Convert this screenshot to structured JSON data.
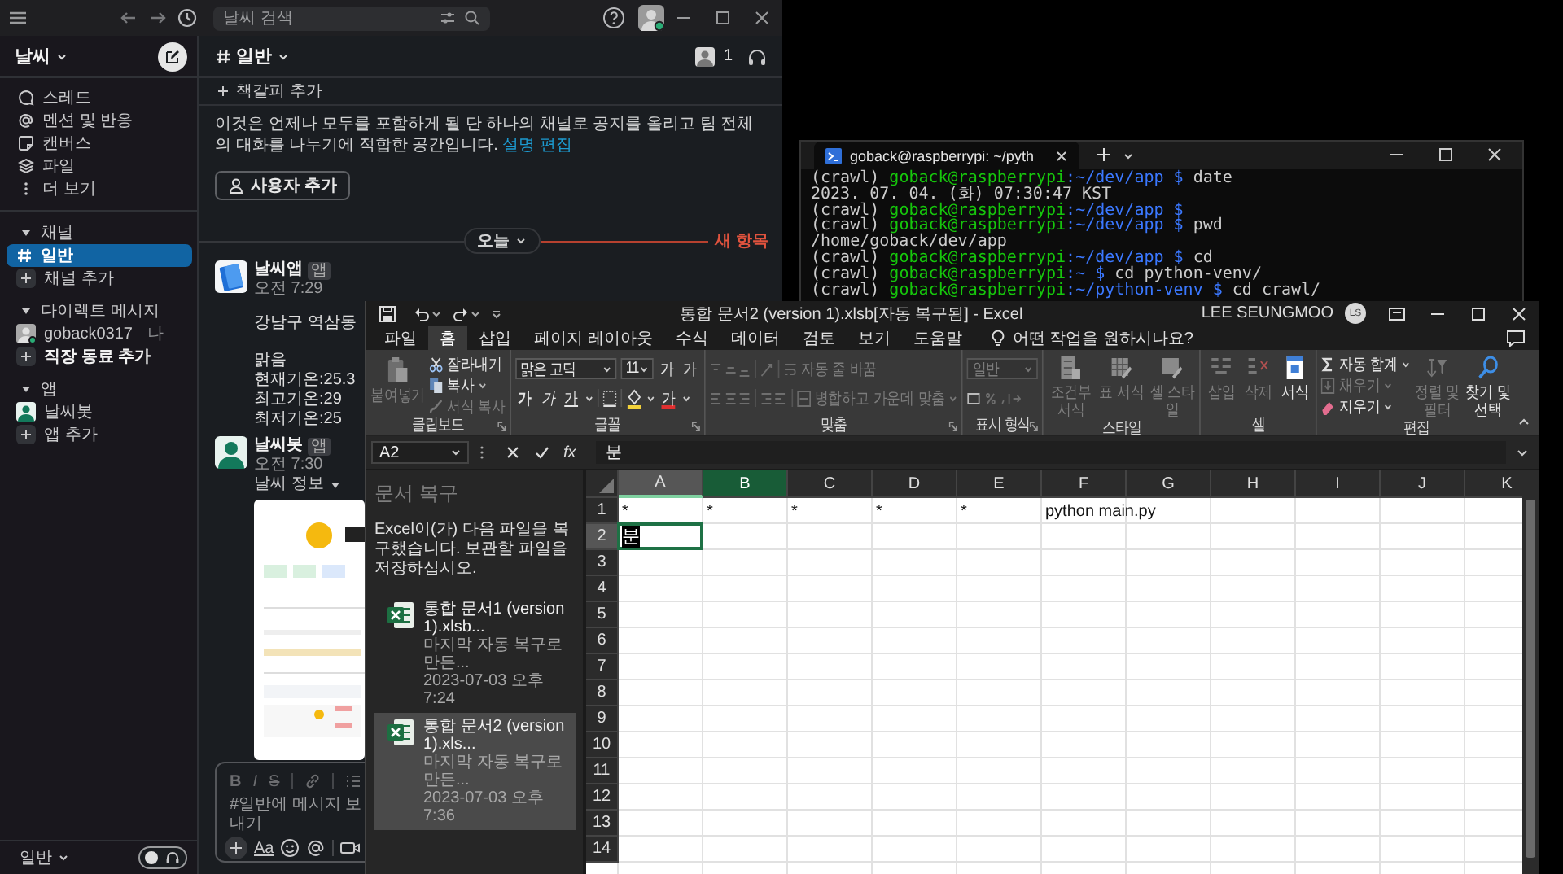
{
  "slack": {
    "titlebar": {
      "search_placeholder": "날씨 검색",
      "online": true
    },
    "workspace": "날씨",
    "nav": [
      {
        "label": "스레드",
        "kind": "threads"
      },
      {
        "label": "멘션 및 반응",
        "kind": "mentions"
      },
      {
        "label": "캔버스",
        "kind": "canvas"
      },
      {
        "label": "파일",
        "kind": "files"
      },
      {
        "label": "더 보기",
        "kind": "more"
      }
    ],
    "sections": [
      {
        "title": "채널",
        "expanded": true,
        "items": [
          {
            "label": "일반",
            "kind": "channel",
            "selected": true,
            "unread": false
          },
          {
            "label": "채널 추가",
            "kind": "add",
            "selected": false,
            "unread": false
          }
        ]
      },
      {
        "title": "다이렉트 메시지",
        "expanded": true,
        "items": [
          {
            "label": "goback0317",
            "suffix": "나",
            "kind": "user",
            "online": true,
            "selected": false,
            "unread": false
          },
          {
            "label": "직장 동료 추가",
            "kind": "add",
            "selected": false,
            "unread": true
          }
        ]
      },
      {
        "title": "앱",
        "expanded": true,
        "items": [
          {
            "label": "날씨봇",
            "kind": "app",
            "selected": false,
            "unread": false
          },
          {
            "label": "앱 추가",
            "kind": "add",
            "selected": false,
            "unread": false
          }
        ]
      }
    ],
    "footer": {
      "label": "일반"
    },
    "channel": {
      "name": "일반",
      "member_count": "1",
      "bookmark": "책갈피 추가",
      "intro": "이것은 언제나 모두를 포함하게 될 단 하나의 채널로 공지를 올리고 팀 전체의 대화를 나누기에 적합한 공간입니다.",
      "intro_link": "설명 편집",
      "add_button": "사용자 추가"
    },
    "divider": {
      "label": "오늘",
      "new_label": "새 항목"
    },
    "messages": [
      {
        "author": "날씨앱",
        "badge": "앱",
        "time": "오전 7:29",
        "paragraphs": [
          [
            "강남구 역삼동"
          ],
          [
            "맑음",
            "현재기온:25.3",
            "최고기온:29",
            "최저기온:25"
          ]
        ]
      },
      {
        "author": "날씨봇",
        "badge": "앱",
        "time": "오전 7:30",
        "attachment_title": "날씨 정보"
      }
    ],
    "composer": {
      "format_buttons": [
        "B",
        "I",
        "S"
      ],
      "placeholder": "#일반에 메시지 보내기",
      "text_button": "Aa"
    }
  },
  "terminal": {
    "tab_title": "goback@raspberrypi: ~/pyth",
    "lines": [
      {
        "kind": "prompt",
        "env": "(crawl)",
        "host": "goback@raspberrypi",
        "path": ":~/dev/app $",
        "cmd": "date"
      },
      {
        "kind": "output",
        "text": "2023. 07. 04. (화) 07:30:47 KST"
      },
      {
        "kind": "prompt",
        "env": "(crawl)",
        "host": "goback@raspberrypi",
        "path": ":~/dev/app $"
      },
      {
        "kind": "prompt",
        "env": "(crawl)",
        "host": "goback@raspberrypi",
        "path": ":~/dev/app $",
        "cmd": "pwd"
      },
      {
        "kind": "output",
        "text": "/home/goback/dev/app"
      },
      {
        "kind": "prompt",
        "env": "(crawl)",
        "host": "goback@raspberrypi",
        "path": ":~/dev/app $",
        "cmd": "cd"
      },
      {
        "kind": "prompt",
        "env": "(crawl)",
        "host": "goback@raspberrypi",
        "path": ":~ $",
        "cmd": "cd python-venv/"
      },
      {
        "kind": "prompt",
        "env": "(crawl)",
        "host": "goback@raspberrypi",
        "path": ":~/python-venv $",
        "cmd": "cd crawl/"
      }
    ]
  },
  "excel": {
    "title": "통합 문서2 (version 1).xlsb[자동 복구됨] - Excel",
    "user": "LEE SEUNGMOO",
    "user_initials": "LS",
    "tabs": [
      {
        "label": "파일",
        "selected": false
      },
      {
        "label": "홈",
        "selected": true
      },
      {
        "label": "삽입",
        "selected": false
      },
      {
        "label": "페이지 레이아웃",
        "selected": false
      },
      {
        "label": "수식",
        "selected": false
      },
      {
        "label": "데이터",
        "selected": false
      },
      {
        "label": "검토",
        "selected": false
      },
      {
        "label": "보기",
        "selected": false
      },
      {
        "label": "도움말",
        "selected": false
      }
    ],
    "tell_me": "어떤 작업을 원하시나요?",
    "ribbon": {
      "clipboard": {
        "label": "클립보드",
        "paste": {
          "label": "붙여넣기",
          "disabled": true
        },
        "cut": {
          "label": "잘라내기",
          "disabled": false
        },
        "copy": {
          "label": "복사",
          "disabled": false
        },
        "painter": {
          "label": "서식 복사",
          "disabled": true
        }
      },
      "font": {
        "label": "글꼴",
        "family": "맑은 고딕",
        "size": "11",
        "grow": "가",
        "shrink": "가",
        "bold": "가",
        "italic": "가",
        "underline": "가",
        "color_letter": "가"
      },
      "alignment": {
        "label": "맞춤",
        "wrap": {
          "label": "자동 줄 바꿈",
          "disabled": true
        },
        "merge": {
          "label": "병합하고 가운데 맞춤",
          "disabled": true
        }
      },
      "number": {
        "label": "표시 형식",
        "format": {
          "label": "일반",
          "disabled": true
        }
      },
      "styles": {
        "label": "스타일",
        "items": [
          {
            "label": "조건부 서식",
            "disabled": true
          },
          {
            "label": "표 서식",
            "disabled": true
          },
          {
            "label": "셀 스타일",
            "disabled": true
          }
        ]
      },
      "cells": {
        "label": "셀",
        "items": [
          {
            "label": "삽입",
            "disabled": true
          },
          {
            "label": "삭제",
            "disabled": true
          },
          {
            "label": "서식",
            "disabled": false
          }
        ]
      },
      "editing": {
        "label": "편집",
        "autosum": {
          "label": "자동 합계",
          "disabled": false
        },
        "fill": {
          "label": "채우기",
          "disabled": true
        },
        "clear": {
          "label": "지우기",
          "disabled": false
        },
        "sort": {
          "label": "정렬 및 필터",
          "disabled": true
        },
        "find": {
          "label": "찾기 및 선택",
          "disabled": false
        }
      }
    },
    "formula_bar": {
      "name_box": "A2",
      "function_button": "fx",
      "value": "분"
    },
    "recovery": {
      "title": "문서 복구",
      "message": "Excel이(가) 다음 파일을 복구했습니다. 보관할 파일을 저장하십시오.",
      "files": [
        {
          "name": "통합 문서1 (version 1).xlsb...",
          "note": "마지막 자동 복구로 만든...",
          "time": "2023-07-03 오후 7:24",
          "selected": false
        },
        {
          "name": "통합 문서2 (version 1).xls...",
          "note": "마지막 자동 복구로 만든...",
          "time": "2023-07-03 오후 7:36",
          "selected": true
        }
      ]
    },
    "columns": [
      {
        "label": "A",
        "active": true,
        "selected": false
      },
      {
        "label": "B",
        "active": false,
        "selected": true
      },
      {
        "label": "C",
        "active": false,
        "selected": false
      },
      {
        "label": "D",
        "active": false,
        "selected": false
      },
      {
        "label": "E",
        "active": false,
        "selected": false
      },
      {
        "label": "F",
        "active": false,
        "selected": false
      },
      {
        "label": "G",
        "active": false,
        "selected": false
      },
      {
        "label": "H",
        "active": false,
        "selected": false
      },
      {
        "label": "I",
        "active": false,
        "selected": false
      },
      {
        "label": "J",
        "active": false,
        "selected": false
      },
      {
        "label": "K",
        "active": false,
        "selected": false
      }
    ],
    "rows": [
      {
        "label": "1",
        "active": false,
        "cells": [
          {
            "text": "*",
            "selected": false,
            "composing": false
          },
          {
            "text": "*",
            "selected": false,
            "composing": false
          },
          {
            "text": "*",
            "selected": false,
            "composing": false
          },
          {
            "text": "*",
            "selected": false,
            "composing": false
          },
          {
            "text": "*",
            "selected": false,
            "composing": false
          },
          {
            "text": "python main.py",
            "selected": false,
            "composing": false
          }
        ]
      },
      {
        "label": "2",
        "active": true,
        "cells": [
          {
            "text": "분",
            "selected": true,
            "composing": true
          }
        ]
      },
      {
        "label": "3",
        "active": false
      },
      {
        "label": "4",
        "active": false
      },
      {
        "label": "5",
        "active": false
      },
      {
        "label": "6",
        "active": false
      },
      {
        "label": "7",
        "active": false
      },
      {
        "label": "8",
        "active": false
      },
      {
        "label": "9",
        "active": false
      },
      {
        "label": "10",
        "active": false
      },
      {
        "label": "11",
        "active": false
      },
      {
        "label": "12",
        "active": false
      },
      {
        "label": "13",
        "active": false
      },
      {
        "label": "14",
        "active": false
      }
    ]
  }
}
